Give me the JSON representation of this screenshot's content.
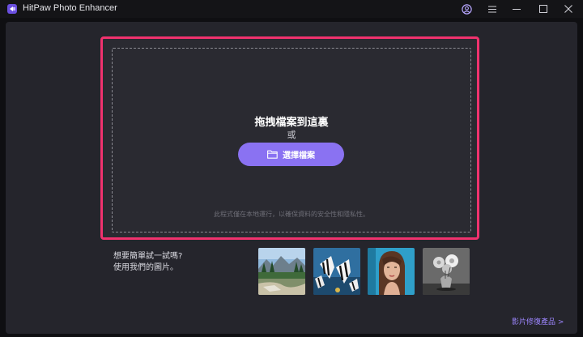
{
  "app": {
    "title": "HitPaw Photo Enhancer",
    "accent": "#8a72f2",
    "highlight": "#f0326e"
  },
  "titlebar": {
    "icons": [
      "account-icon",
      "menu-icon",
      "minimize-icon",
      "maximize-icon",
      "close-icon"
    ]
  },
  "drop_zone": {
    "title": "拖拽檔案到這裏",
    "or_text": "或",
    "select_button_label": "選擇檔案",
    "privacy_note": "此程式僅在本地運行，以確保資料的安全性和隱私性。"
  },
  "samples": {
    "prompt_line1": "想要簡單試一試嗎?",
    "prompt_line2": "使用我們的圖片。",
    "images": [
      "landscape-sample",
      "fish-sample",
      "portrait-sample",
      "flower-sample"
    ]
  },
  "footer": {
    "product_link": "影片修復產品 >"
  }
}
